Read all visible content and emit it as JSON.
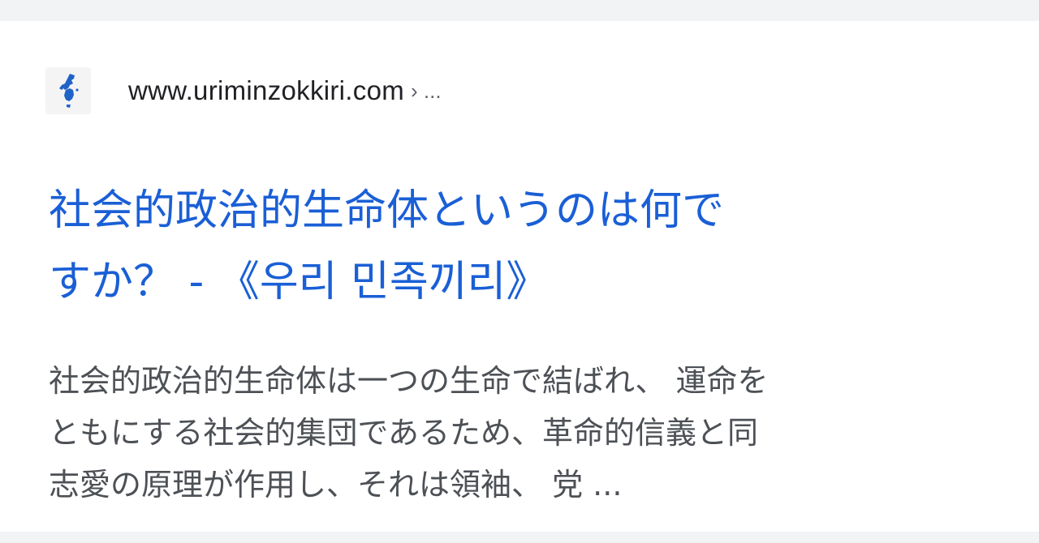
{
  "result": {
    "favicon": "korea-map-icon",
    "site_url": "www.urimin­zokkiri.com",
    "breadcrumb": "› ...",
    "title_line1": "社会的政治的生命体というのは何で",
    "title_line2": "すか？ - 《우리 민족끼리》",
    "snippet_line1": "社会的政治的生命体は一つの生命で結ばれ、 運命を",
    "snippet_line2": "ともにする社会的集団であるため、革命的信義と同",
    "snippet_line3": "志愛の原理が作用し、それは領袖、 党 ..."
  },
  "colors": {
    "title_link": "#1a5fd6",
    "snippet_text": "#4d5156",
    "url_text": "#202124",
    "page_bg": "#f1f3f4",
    "card_bg": "#ffffff",
    "favicon_blue": "#1f63c6"
  }
}
